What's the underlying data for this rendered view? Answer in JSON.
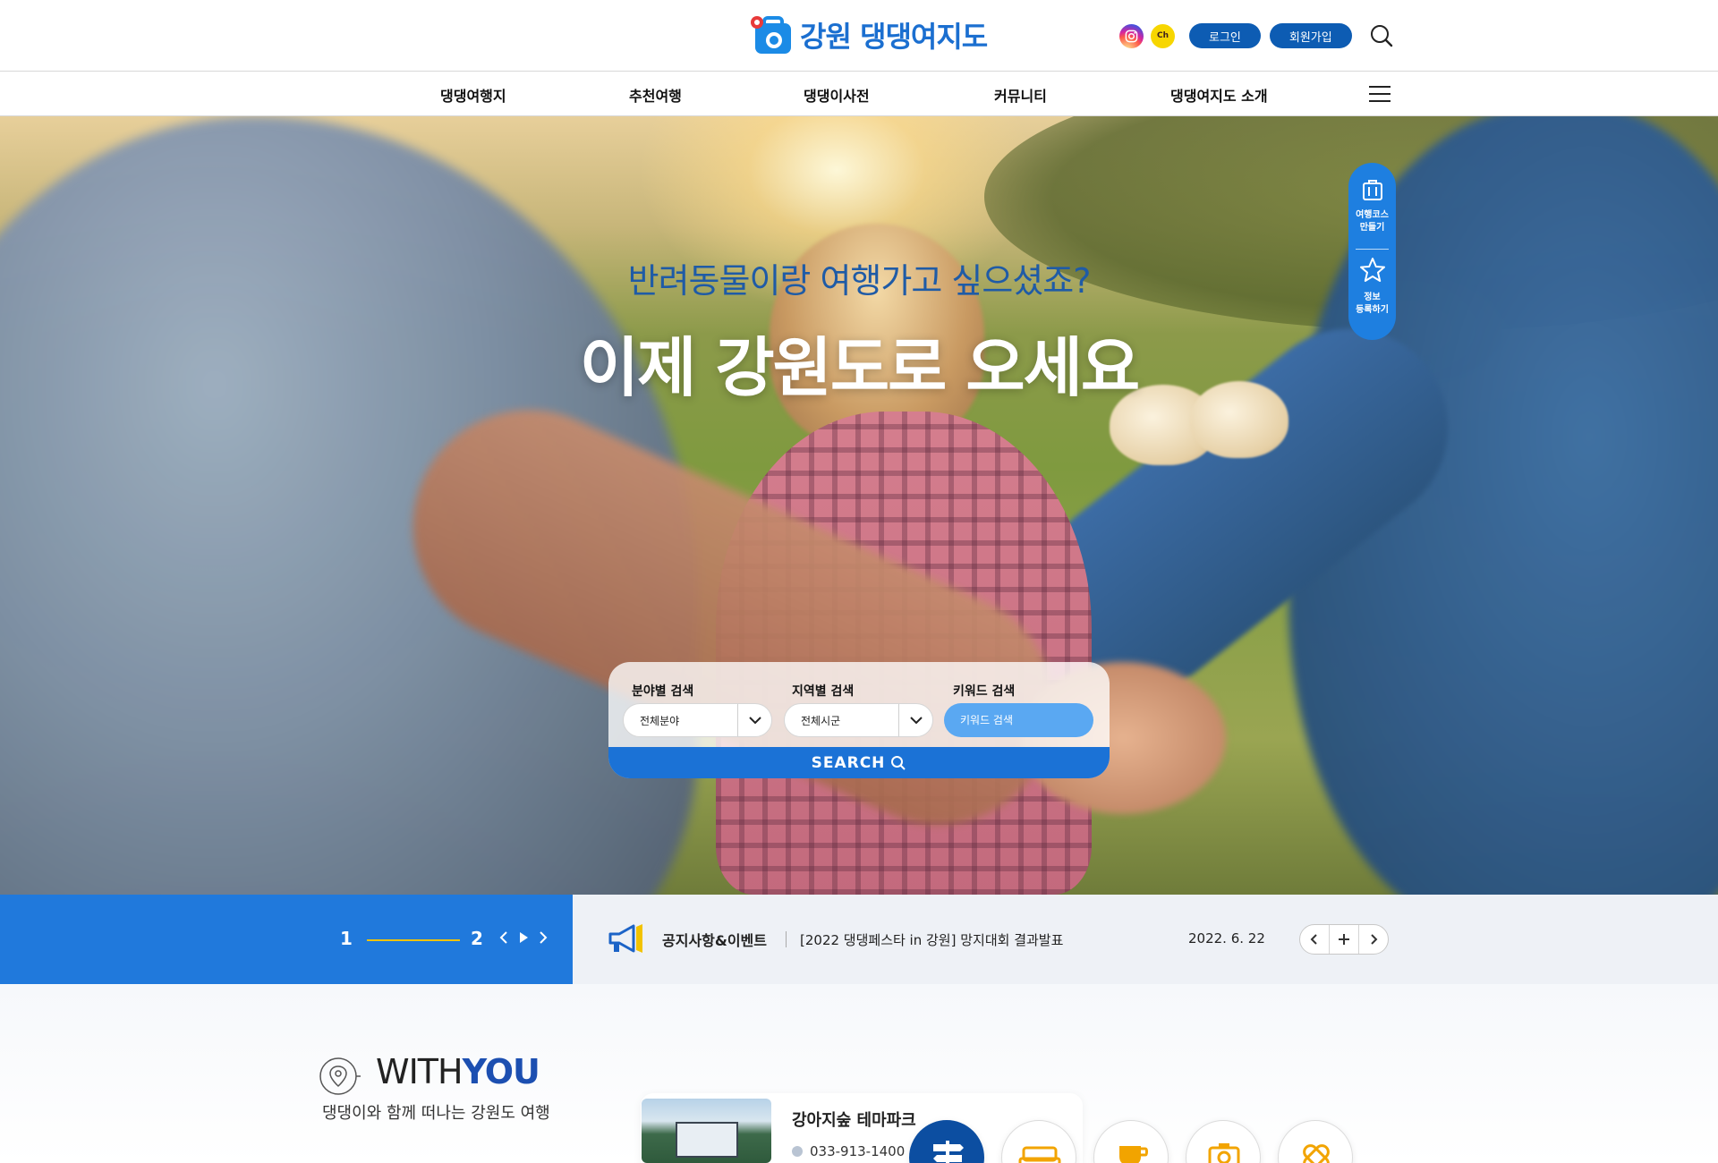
{
  "header": {
    "logo_text": "강원 댕댕여지도",
    "kakao_label": "Ch",
    "login_label": "로그인",
    "join_label": "회원가입"
  },
  "nav": {
    "items": [
      {
        "label": "댕댕여행지"
      },
      {
        "label": "추천여행"
      },
      {
        "label": "댕댕이사전"
      },
      {
        "label": "커뮤니티"
      },
      {
        "label": "댕댕여지도 소개"
      }
    ]
  },
  "hero": {
    "subtitle": "반려동물이랑 여행가고 싶으셨죠?",
    "title": "이제 강원도로 오세요"
  },
  "quick_menu": {
    "item1": "여행코스\n만들기",
    "item1_line1": "여행코스",
    "item1_line2": "만들기",
    "item2_line1": "정보",
    "item2_line2": "등록하기"
  },
  "search": {
    "category_label": "분야별 검색",
    "category_value": "전체분야",
    "region_label": "지역별 검색",
    "region_value": "전체시군",
    "keyword_label": "키워드 검색",
    "keyword_placeholder": "키워드 검색",
    "button_label": "SEARCH"
  },
  "slider": {
    "current": "1",
    "total": "2"
  },
  "notice": {
    "title": "공지사항&이벤트",
    "text": "[2022 댕댕페스타 in 강원] 망지대회 결과발표",
    "date": "2022. 6. 22"
  },
  "withyou": {
    "title_light": "WITH",
    "title_bold": "YOU",
    "subtitle": "댕댕이와 함께 떠나는 강원도 여행"
  },
  "card": {
    "name": "강아지숲 테마파크",
    "phone": "033-913-1400"
  },
  "colors": {
    "brand_blue": "#1b72d6",
    "nav_pill": "#0d5cb3",
    "accent_yellow": "#f2c300"
  }
}
